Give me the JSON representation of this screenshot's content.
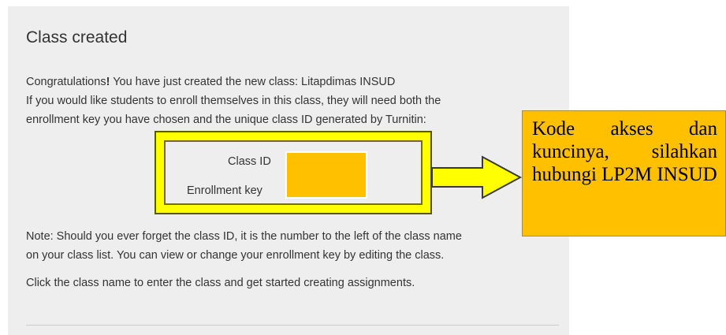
{
  "page": {
    "title": "Class created",
    "congrats_text": "Congratulations",
    "congrats_excl": "!",
    "congrats_rest": " You have just created the new class: Litapdimas INSUD",
    "enroll_line1": "If you would like students to enroll themselves in this class, they will need both the",
    "enroll_line2": "enrollment key you have chosen and the unique class ID generated by Turnitin:",
    "class_id_label": "Class ID",
    "enrollment_key_label": "Enrollment key",
    "class_id_value": "",
    "enrollment_key_value": "",
    "note_line1": "Note: Should you ever forget the class ID, it is the number to the left of the class name",
    "note_line2": "on your class list. You can view or change your enrollment key by editing the class.",
    "click_line": "Click the class name to enter the class and get started creating assignments."
  },
  "annotation": {
    "callout_text": "Kode akses dan kuncinya, silahkan hubungi LP2M INSUD"
  },
  "colors": {
    "highlight_yellow": "#ffff00",
    "redaction_orange": "#ffc000",
    "panel_gray": "#eeeeee"
  }
}
